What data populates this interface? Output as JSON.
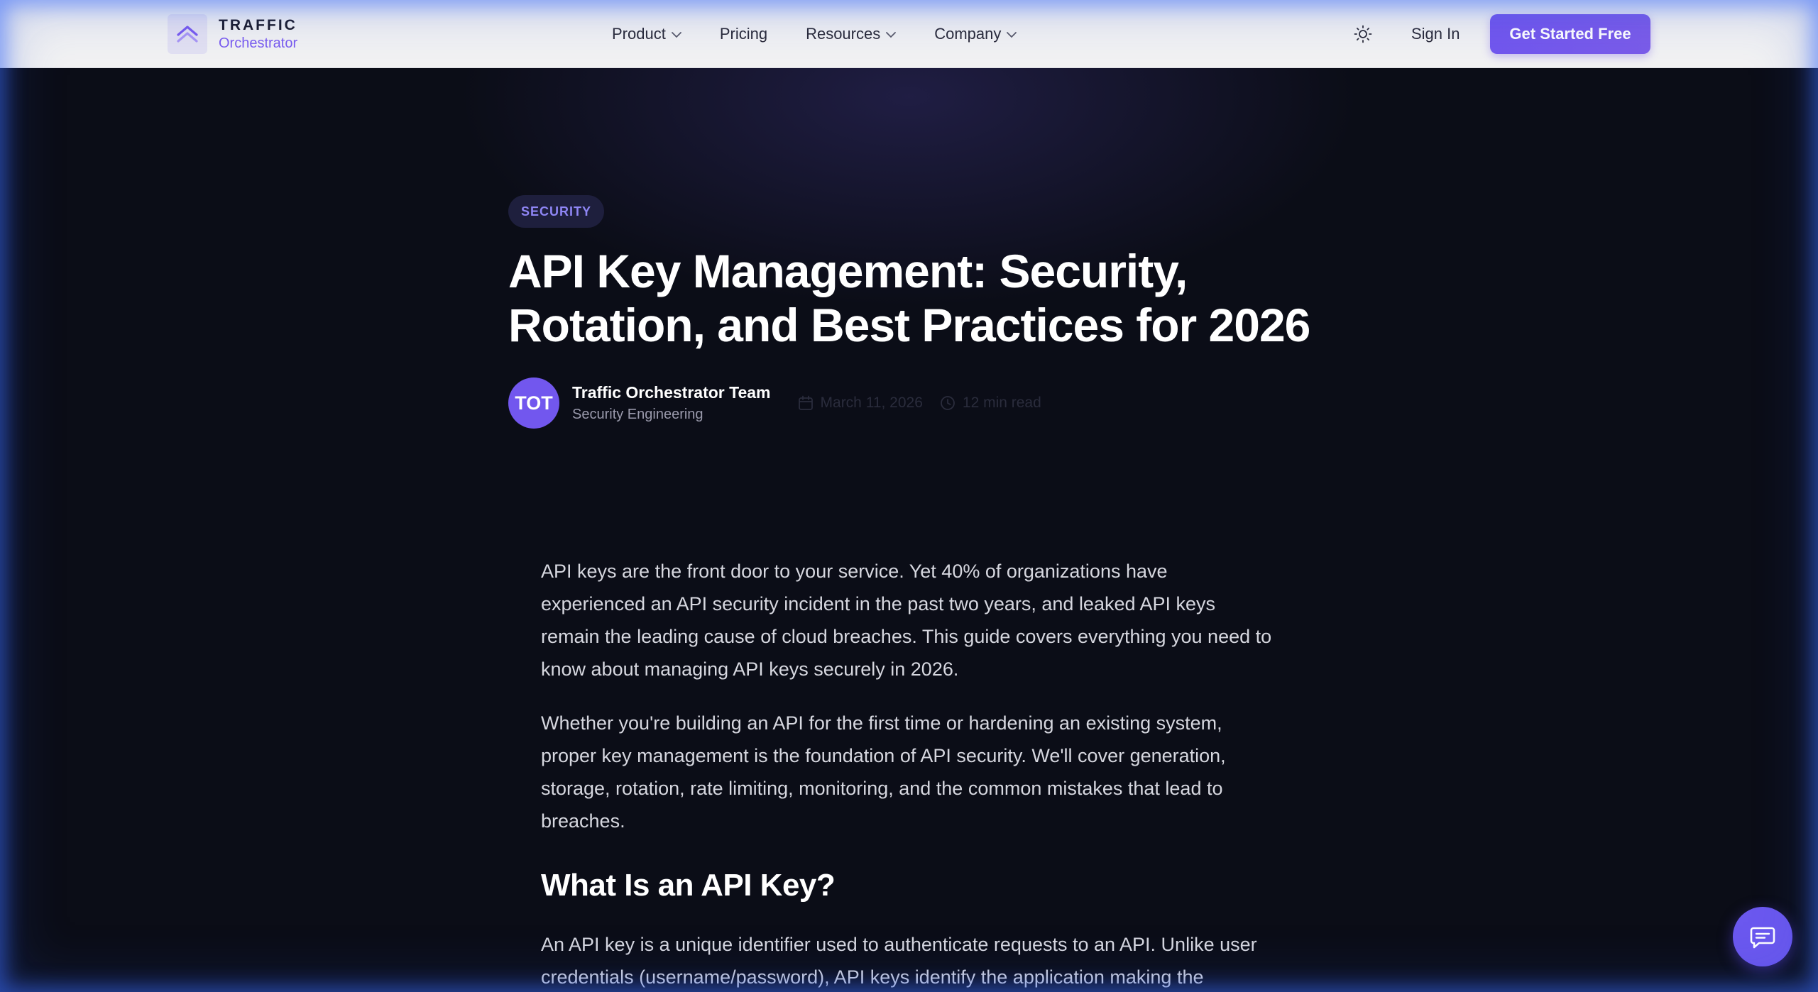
{
  "header": {
    "logo_top": "TRAFFIC",
    "logo_bottom": "Orchestrator",
    "nav": [
      {
        "label": "Product",
        "has_dropdown": true
      },
      {
        "label": "Pricing",
        "has_dropdown": false
      },
      {
        "label": "Resources",
        "has_dropdown": true
      },
      {
        "label": "Company",
        "has_dropdown": true
      }
    ],
    "theme_icon": "sun-icon",
    "sign_in": "Sign In",
    "cta": "Get Started Free"
  },
  "article": {
    "category": "SECURITY",
    "title": "API Key Management: Security, Rotation, and Best Practices for 2026",
    "author": {
      "initials": "TOT",
      "name": "Traffic Orchestrator Team",
      "role": "Security Engineering"
    },
    "date": "March 11, 2026",
    "read_time": "12 min read",
    "paragraphs": [
      "API keys are the front door to your service. Yet 40% of organizations have experienced an API security incident in the past two years, and leaked API keys remain the leading cause of cloud breaches. This guide covers everything you need to know about managing API keys securely in 2026.",
      "Whether you're building an API for the first time or hardening an existing system, proper key management is the foundation of API security. We'll cover generation, storage, rotation, rate limiting, monitoring, and the common mistakes that lead to breaches."
    ],
    "heading_1": "What Is an API Key?",
    "paragraph_3": "An API key is a unique identifier used to authenticate requests to an API. Unlike user credentials (username/password), API keys identify the application making the"
  },
  "chat": {
    "icon": "chat-bubble-icon"
  },
  "colors": {
    "accent": "#7257ee",
    "background": "#0b0d17",
    "header_bg": "#f2f2f3",
    "tag_text": "#8f86f5"
  }
}
